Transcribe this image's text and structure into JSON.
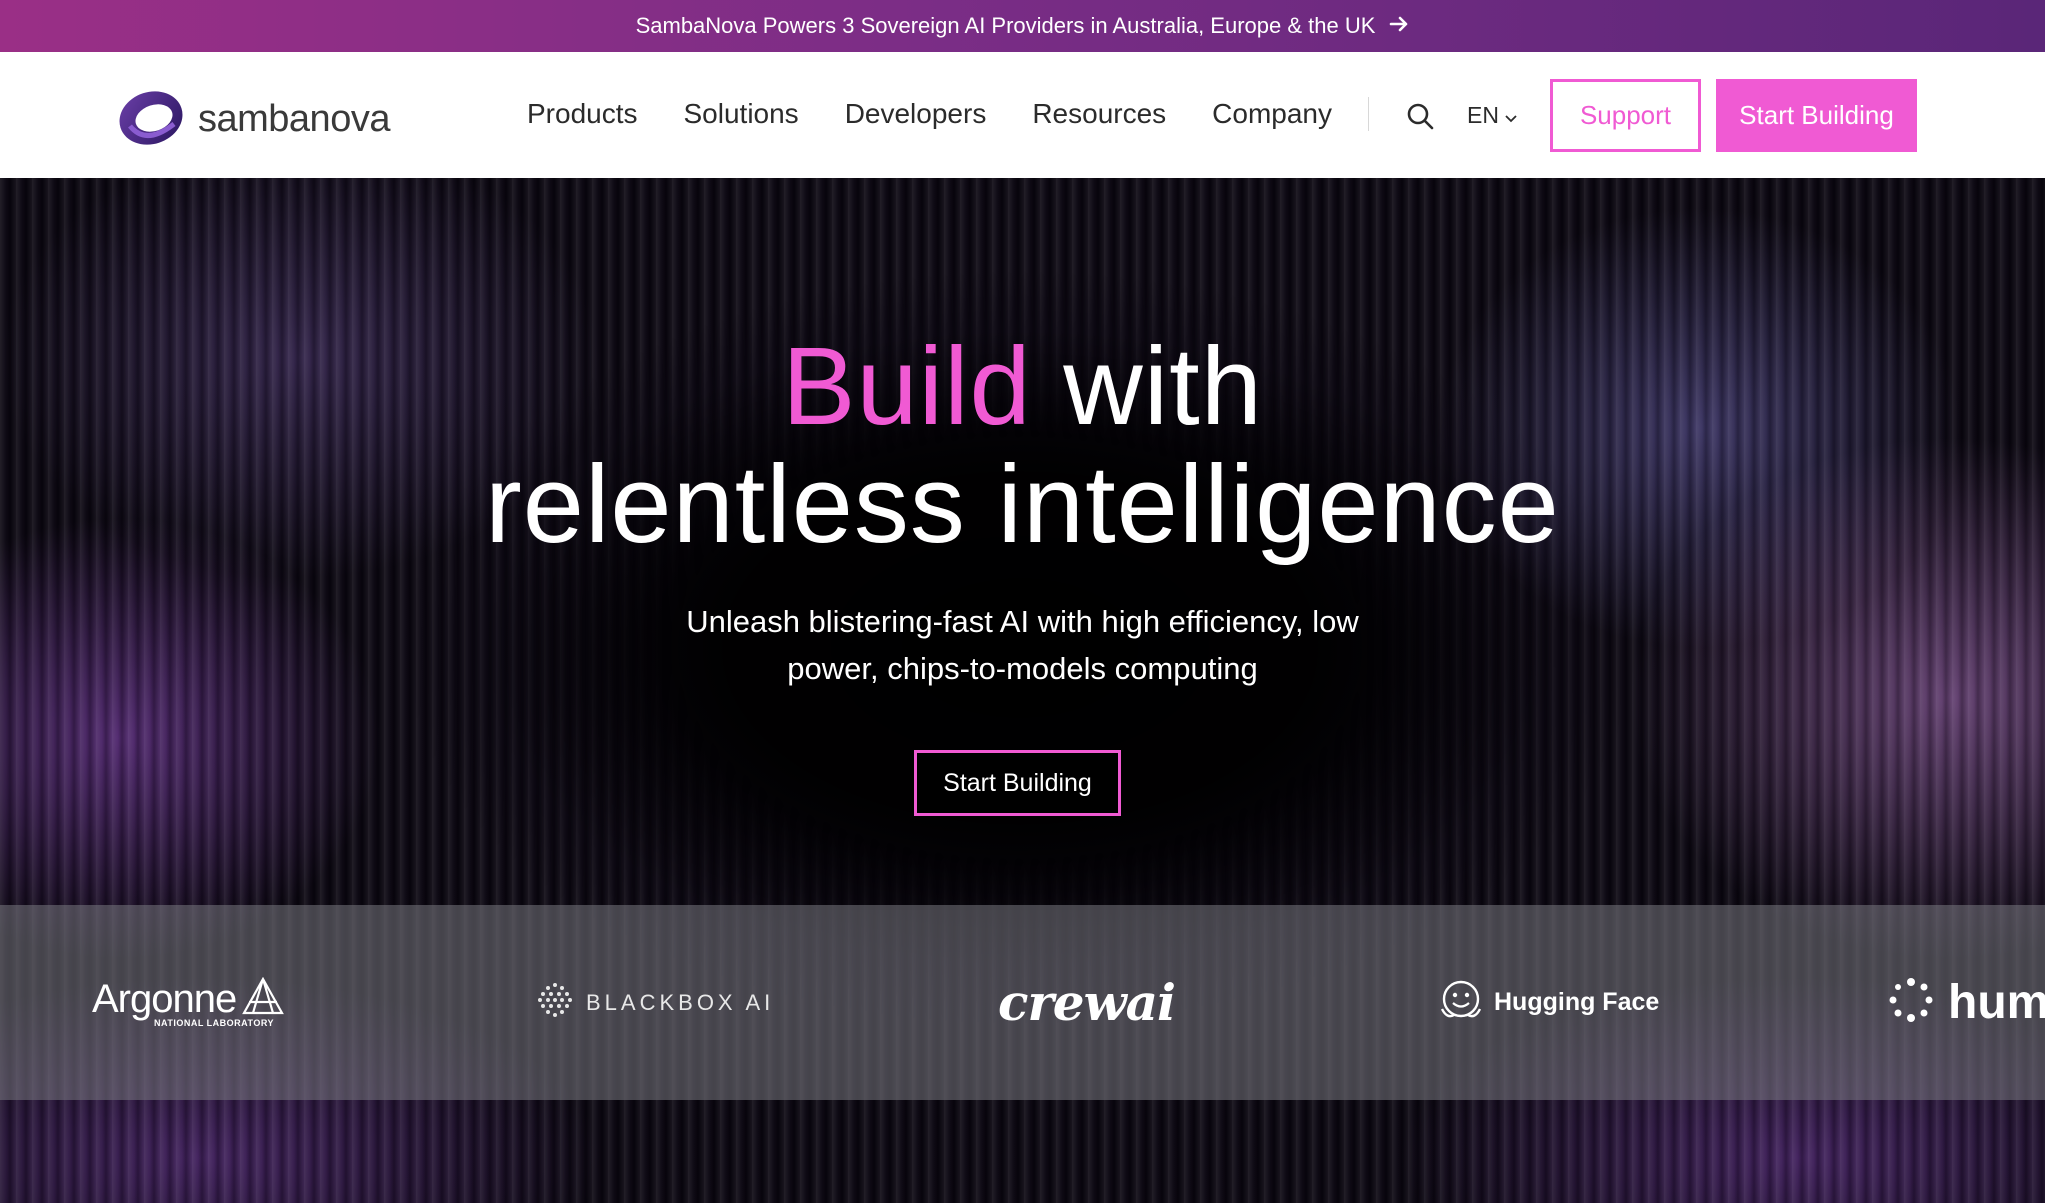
{
  "announcement": {
    "text": "SambaNova Powers 3 Sovereign AI Providers in Australia, Europe & the UK",
    "icon": "arrow-right-icon"
  },
  "header": {
    "logo_text": "sambanova",
    "nav": [
      "Products",
      "Solutions",
      "Developers",
      "Resources",
      "Company"
    ],
    "language": "EN",
    "support_label": "Support",
    "start_label": "Start Building"
  },
  "hero": {
    "headline_accent": "Build",
    "headline_rest": " with",
    "headline_line2": "relentless intelligence",
    "subhead_line1": "Unleash blistering-fast AI with high efficiency, low",
    "subhead_line2": "power, chips-to-models computing",
    "cta_label": "Start Building"
  },
  "partners": {
    "argonne": "Argonne",
    "argonne_sub": "NATIONAL LABORATORY",
    "blackbox": "BLACKBOX AI",
    "crewai": "crewai",
    "hugging_face": "Hugging Face",
    "hum": "hum"
  },
  "colors": {
    "accent": "#f05ad3",
    "announce_start": "#9a2f86",
    "announce_end": "#5a2678"
  }
}
